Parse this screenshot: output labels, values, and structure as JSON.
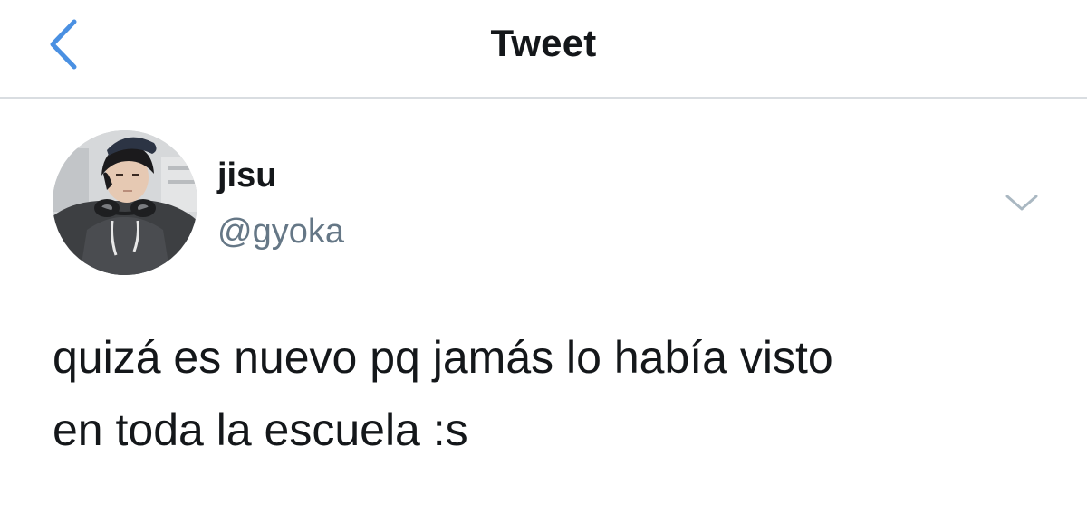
{
  "header": {
    "title": "Tweet",
    "back_icon": "chevron-left-icon",
    "accent_color": "#4a90e2"
  },
  "tweet": {
    "author": {
      "display_name": "jisu",
      "handle": "@gyoka",
      "avatar": "profile-photo"
    },
    "menu_icon": "chevron-down-icon",
    "text_lines": [
      "quizá es nuevo pq jamás lo había visto",
      "en toda la escuela :s"
    ]
  }
}
